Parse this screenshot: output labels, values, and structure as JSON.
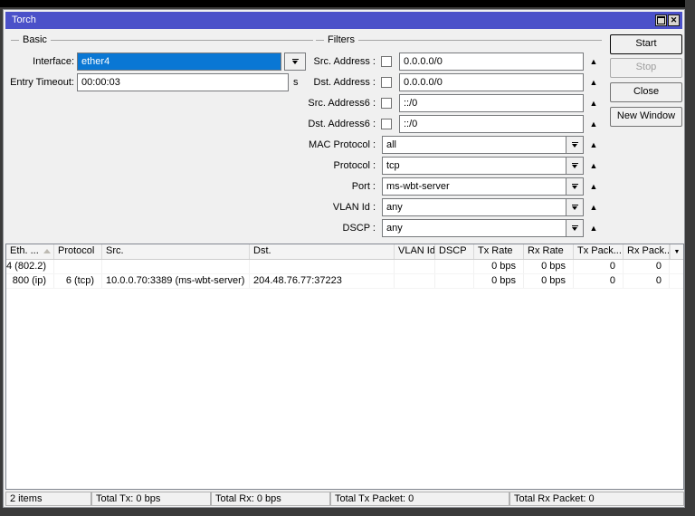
{
  "window": {
    "title": "Torch"
  },
  "basic": {
    "group_label": "Basic",
    "interface_label": "Interface:",
    "interface_value": "ether4",
    "entry_timeout_label": "Entry Timeout:",
    "entry_timeout_value": "00:00:03",
    "entry_timeout_unit": "s"
  },
  "filters": {
    "group_label": "Filters",
    "rows": [
      {
        "label": "Src. Address :",
        "type": "checkbox-input",
        "checked": false,
        "value": "0.0.0.0/0"
      },
      {
        "label": "Dst. Address :",
        "type": "checkbox-input",
        "checked": false,
        "value": "0.0.0.0/0"
      },
      {
        "label": "Src. Address6 :",
        "type": "checkbox-input",
        "checked": false,
        "value": "::/0"
      },
      {
        "label": "Dst. Address6 :",
        "type": "checkbox-input",
        "checked": false,
        "value": "::/0"
      },
      {
        "label": "MAC Protocol :",
        "type": "dropdown",
        "value": "all"
      },
      {
        "label": "Protocol :",
        "type": "dropdown",
        "value": "tcp"
      },
      {
        "label": "Port :",
        "type": "dropdown",
        "value": "ms-wbt-server"
      },
      {
        "label": "VLAN Id :",
        "type": "dropdown",
        "value": "any"
      },
      {
        "label": "DSCP :",
        "type": "dropdown",
        "value": "any"
      }
    ]
  },
  "action_buttons": [
    {
      "label": "Start",
      "default": true,
      "disabled": false
    },
    {
      "label": "Stop",
      "default": false,
      "disabled": true
    },
    {
      "label": "Close",
      "default": false,
      "disabled": false
    },
    {
      "label": "New Window",
      "default": false,
      "disabled": false
    }
  ],
  "table": {
    "columns": [
      "Eth. ...",
      "Protocol",
      "Src.",
      "Dst.",
      "VLAN Id",
      "DSCP",
      "Tx Rate",
      "Rx Rate",
      "Tx Pack...",
      "Rx Pack..."
    ],
    "sort_column_index": 0,
    "rows": [
      [
        "4 (802.2)",
        "",
        "",
        "",
        "",
        "",
        "0 bps",
        "0 bps",
        "0",
        "0"
      ],
      [
        "800 (ip)",
        "6 (tcp)",
        "10.0.0.70:3389 (ms-wbt-server)",
        "204.48.76.77:37223",
        "",
        "",
        "0 bps",
        "0 bps",
        "0",
        "0"
      ]
    ]
  },
  "statusbar": {
    "items": [
      "2 items",
      "Total Tx: 0 bps",
      "Total Rx: 0 bps",
      "Total Tx Packet: 0",
      "Total Rx Packet: 0"
    ]
  },
  "colors": {
    "titlebar": "#4b51c9",
    "selection": "#0a77d4"
  }
}
